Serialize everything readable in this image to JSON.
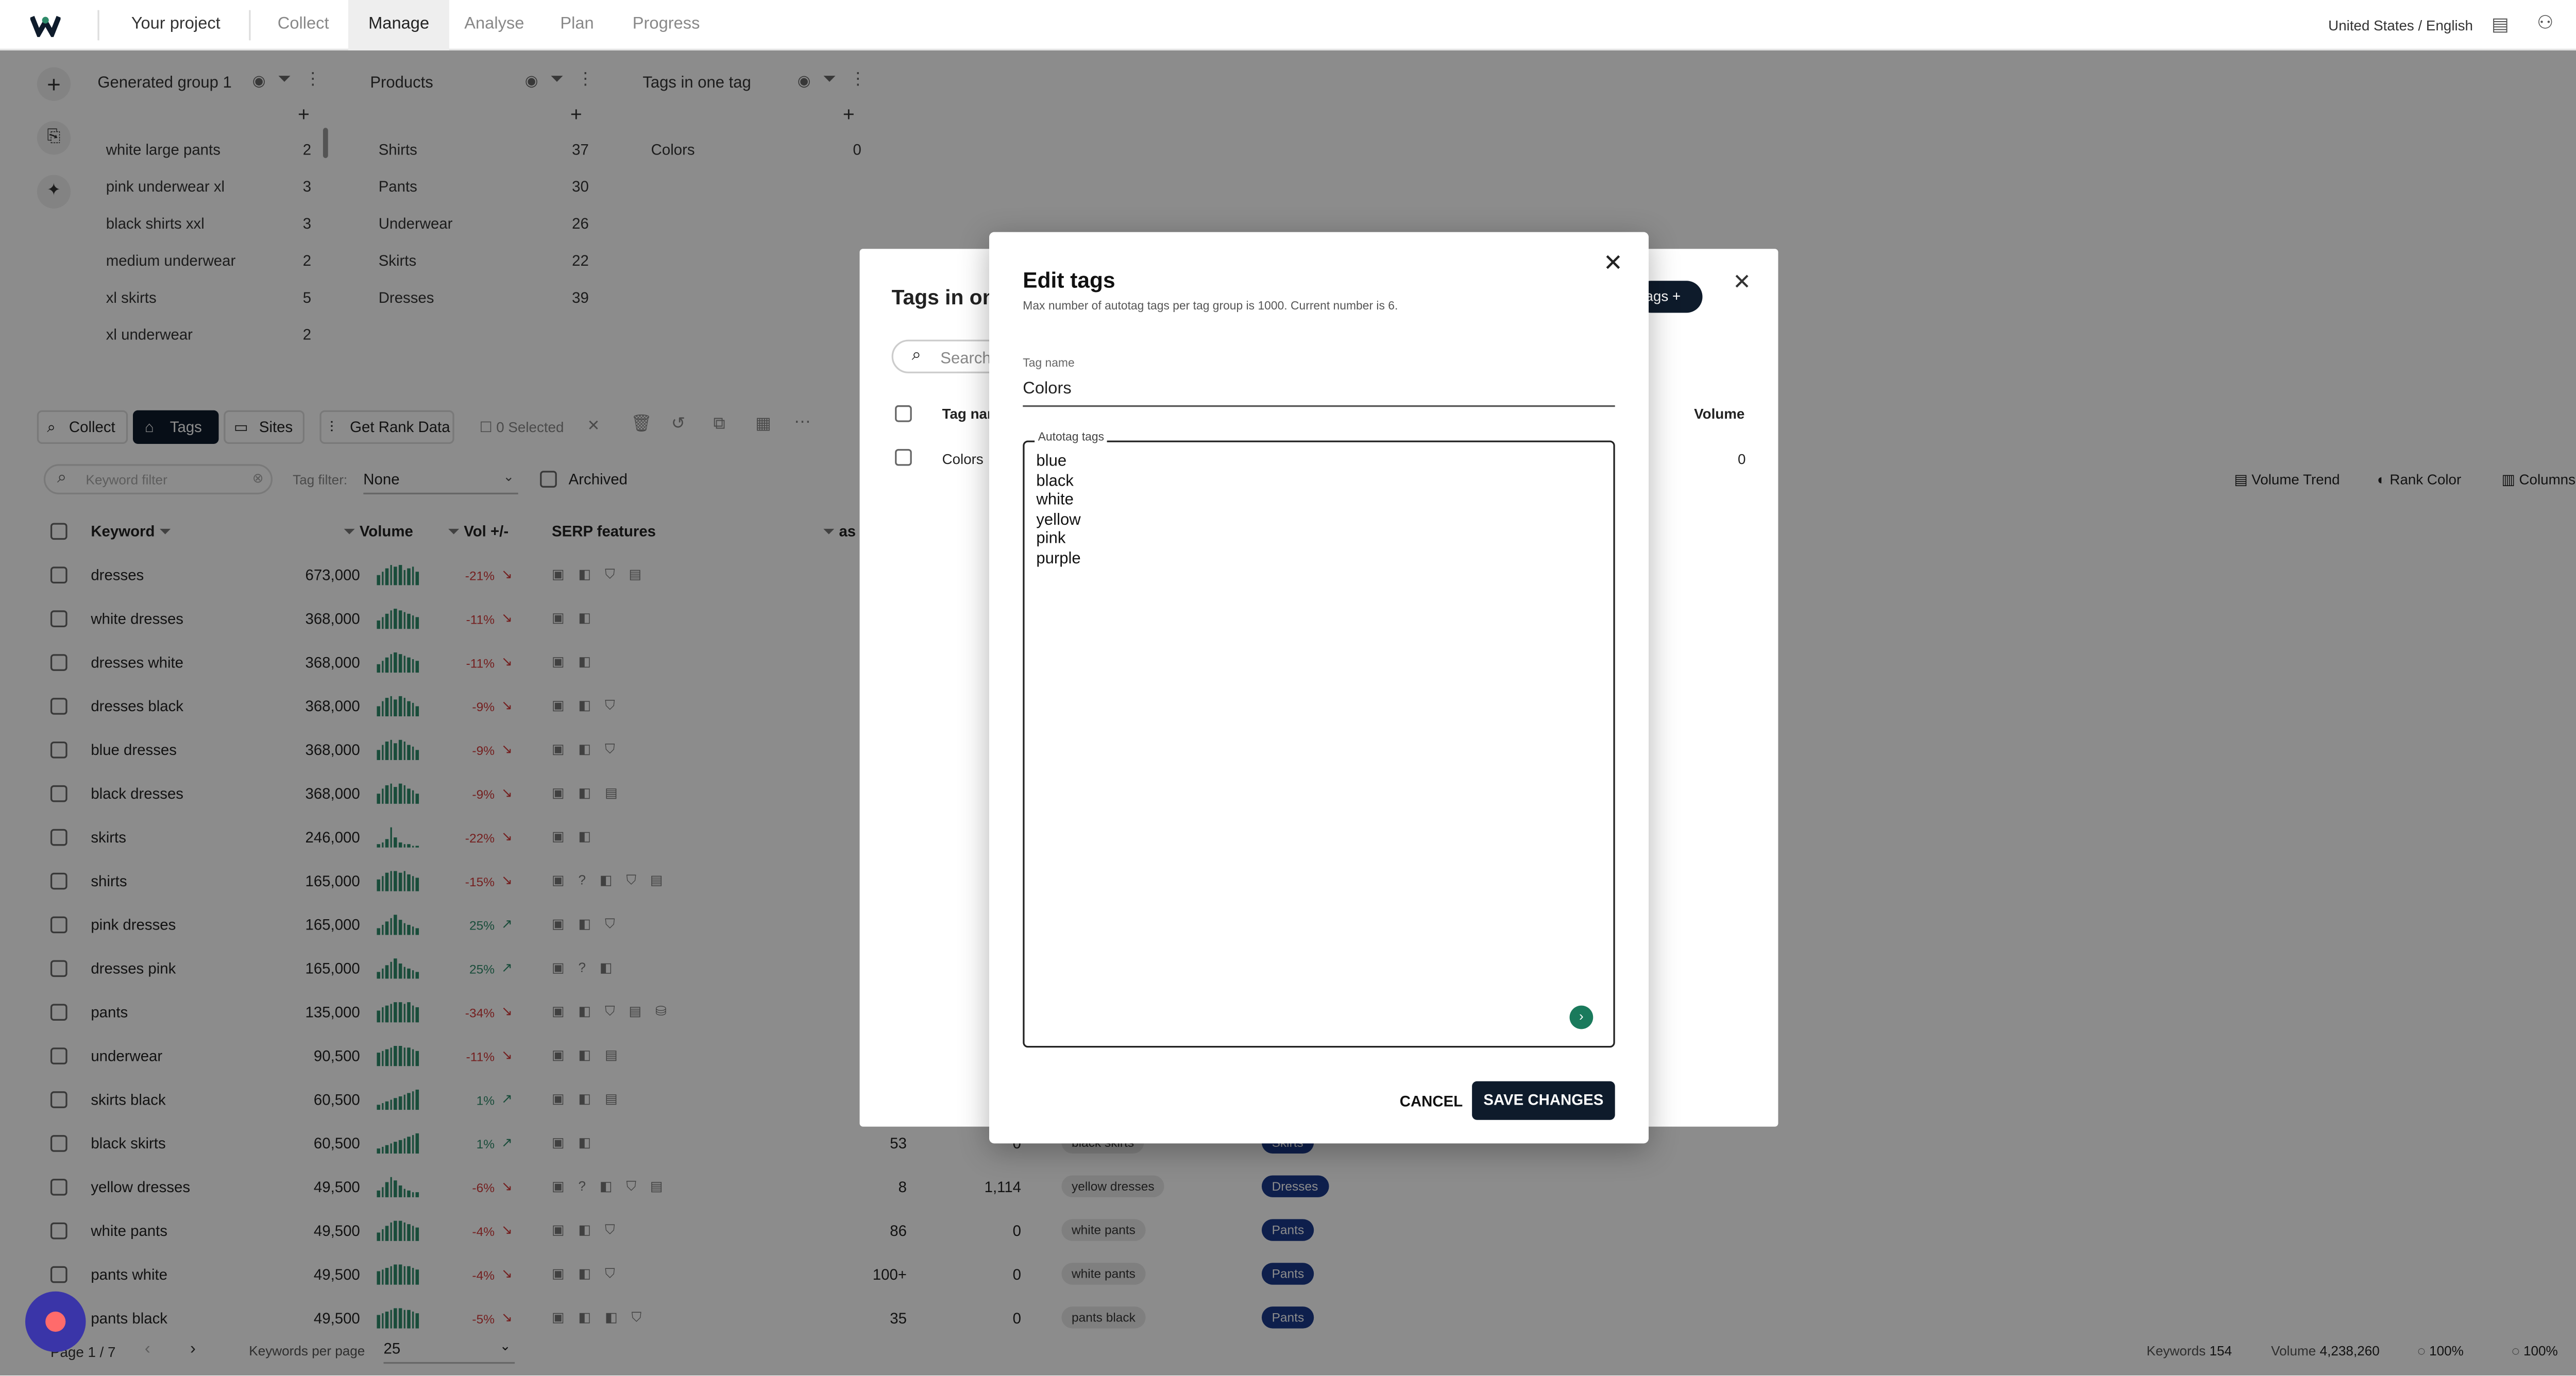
{
  "topbar": {
    "project": "Your project",
    "nav": [
      "Collect",
      "Manage",
      "Analyse",
      "Plan",
      "Progress"
    ],
    "active_nav": "Manage",
    "locale": "United States / English"
  },
  "groups": [
    {
      "title": "Generated group 1",
      "items": [
        {
          "label": "white large pants",
          "count": "2"
        },
        {
          "label": "pink underwear xl",
          "count": "3"
        },
        {
          "label": "black shirts xxl",
          "count": "3"
        },
        {
          "label": "medium underwear",
          "count": "2"
        },
        {
          "label": "xl skirts",
          "count": "5"
        },
        {
          "label": "xl underwear",
          "count": "2"
        }
      ]
    },
    {
      "title": "Products",
      "items": [
        {
          "label": "Shirts",
          "count": "37"
        },
        {
          "label": "Pants",
          "count": "30"
        },
        {
          "label": "Underwear",
          "count": "26"
        },
        {
          "label": "Skirts",
          "count": "22"
        },
        {
          "label": "Dresses",
          "count": "39"
        }
      ]
    },
    {
      "title": "Tags in one tag",
      "items": [
        {
          "label": "Colors",
          "count": "0"
        }
      ]
    }
  ],
  "toolbar": {
    "collect": "Collect",
    "tags": "Tags",
    "sites": "Sites",
    "get_rank_data": "Get Rank Data",
    "selected": "0 Selected"
  },
  "filters": {
    "keyword_placeholder": "Keyword filter",
    "tag_filter_label": "Tag filter:",
    "tag_filter_value": "None",
    "archived": "Archived",
    "volume_trend": "Volume Trend",
    "rank_color": "Rank Color",
    "columns": "Columns"
  },
  "table": {
    "headers": {
      "keyword": "Keyword",
      "volume": "Volume",
      "vol_change": "Vol +/-",
      "serp": "SERP features",
      "other": "as"
    },
    "rows": [
      {
        "keyword": "dresses",
        "volume": "673,000",
        "change": "-21%",
        "dir": "down",
        "serp": "▣ ◧ ⛉ ▤"
      },
      {
        "keyword": "white dresses",
        "volume": "368,000",
        "change": "-11%",
        "dir": "down",
        "serp": "▣ ◧"
      },
      {
        "keyword": "dresses white",
        "volume": "368,000",
        "change": "-11%",
        "dir": "down",
        "serp": "▣ ◧"
      },
      {
        "keyword": "dresses black",
        "volume": "368,000",
        "change": "-9%",
        "dir": "down",
        "serp": "▣ ◧ ⛉"
      },
      {
        "keyword": "blue dresses",
        "volume": "368,000",
        "change": "-9%",
        "dir": "down",
        "serp": "▣ ◧ ⛉"
      },
      {
        "keyword": "black dresses",
        "volume": "368,000",
        "change": "-9%",
        "dir": "down",
        "serp": "▣ ◧ ▤"
      },
      {
        "keyword": "skirts",
        "volume": "246,000",
        "change": "-22%",
        "dir": "down",
        "serp": "▣ ◧"
      },
      {
        "keyword": "shirts",
        "volume": "165,000",
        "change": "-15%",
        "dir": "down",
        "serp": "▣ ? ◧ ⛉ ▤"
      },
      {
        "keyword": "pink dresses",
        "volume": "165,000",
        "change": "25%",
        "dir": "up",
        "serp": "▣ ◧ ⛉"
      },
      {
        "keyword": "dresses pink",
        "volume": "165,000",
        "change": "25%",
        "dir": "up",
        "serp": "▣ ? ◧"
      },
      {
        "keyword": "pants",
        "volume": "135,000",
        "change": "-34%",
        "dir": "down",
        "serp": "▣ ◧ ⛉ ▤ ⛁"
      },
      {
        "keyword": "underwear",
        "volume": "90,500",
        "change": "-11%",
        "dir": "down",
        "serp": "▣ ◧ ▤"
      },
      {
        "keyword": "skirts black",
        "volume": "60,500",
        "change": "1%",
        "dir": "up",
        "serp": "▣ ◧ ▤"
      },
      {
        "keyword": "black skirts",
        "volume": "60,500",
        "change": "1%",
        "dir": "up",
        "serp": "▣ ◧",
        "c1": "53",
        "c2": "0",
        "tag": "black skirts",
        "group": "Skirts"
      },
      {
        "keyword": "yellow dresses",
        "volume": "49,500",
        "change": "-6%",
        "dir": "down",
        "serp": "▣ ? ◧ ⛉ ▤",
        "c1": "8",
        "c2": "1,114",
        "tag": "yellow dresses",
        "group": "Dresses"
      },
      {
        "keyword": "white pants",
        "volume": "49,500",
        "change": "-4%",
        "dir": "down",
        "serp": "▣ ◧ ⛉",
        "c1": "86",
        "c2": "0",
        "tag": "white pants",
        "group": "Pants"
      },
      {
        "keyword": "pants white",
        "volume": "49,500",
        "change": "-4%",
        "dir": "down",
        "serp": "▣ ◧ ⛉",
        "c1": "100+",
        "c2": "0",
        "tag": "white pants",
        "group": "Pants"
      },
      {
        "keyword": "pants black",
        "volume": "49,500",
        "change": "-5%",
        "dir": "down",
        "serp": "▣ ◧ ◧ ⛉",
        "c1": "35",
        "c2": "0",
        "tag": "pants black",
        "group": "Pants"
      }
    ]
  },
  "footer": {
    "page": "Page 1 / 7",
    "per_page_label": "Keywords per page",
    "per_page": "25",
    "keywords_label": "Keywords",
    "keywords": "154",
    "volume_label": "Volume",
    "volume": "4,238,260",
    "pct1": "100%",
    "pct2": "100%"
  },
  "dialog_behind": {
    "title": "Tags in on",
    "search_placeholder": "Search",
    "add_button": "ags",
    "col_tag": "Tag nar",
    "col_volume": "Volume",
    "row_tag": "Colors",
    "row_volume": "0"
  },
  "modal": {
    "title": "Edit tags",
    "subtitle": "Max number of autotag tags per tag group is 1000. Current number is 6.",
    "tag_name_label": "Tag name",
    "tag_name_value": "Colors",
    "autotag_label": "Autotag tags",
    "autotag_value": "blue\nblack\nwhite\nyellow\npink\npurple",
    "cancel": "CANCEL",
    "save": "SAVE CHANGES"
  },
  "colors": {
    "primary": "#0e1b2b",
    "spark": "#2e8b6a",
    "down": "#d33a3a",
    "up": "#2e8b6a",
    "chat": "#3a35a8"
  }
}
